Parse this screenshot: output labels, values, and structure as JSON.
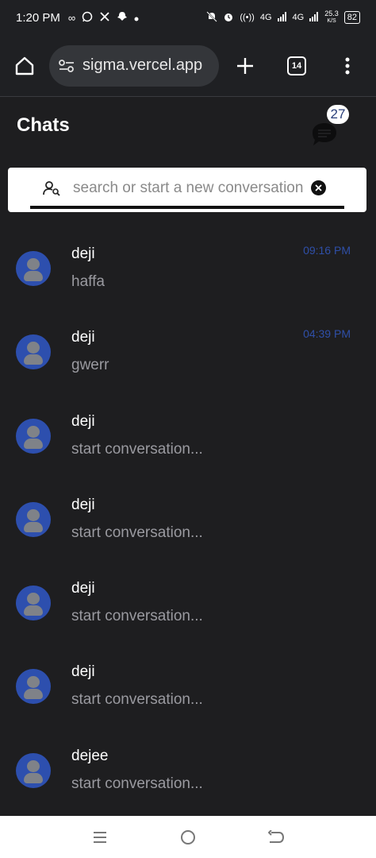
{
  "status_bar": {
    "time": "1:20 PM",
    "left_icons": [
      "infinity-icon",
      "whatsapp-icon",
      "x-icon",
      "snapchat-icon",
      "dot-icon"
    ],
    "network_1": "4G",
    "network_2": "4G",
    "speed": "25.3",
    "speed_unit": "K/S",
    "battery": "82"
  },
  "browser": {
    "url": "sigma.vercel.app",
    "tab_count": "14"
  },
  "header": {
    "title": "Chats",
    "unread_count": "27"
  },
  "search": {
    "placeholder": "search or start a new conversation"
  },
  "chats": [
    {
      "name": "deji",
      "preview": "haffa",
      "time": "09:16 PM"
    },
    {
      "name": "deji",
      "preview": "gwerr",
      "time": "04:39 PM"
    },
    {
      "name": "deji",
      "preview": "start conversation...",
      "time": ""
    },
    {
      "name": "deji",
      "preview": "start conversation...",
      "time": ""
    },
    {
      "name": "deji",
      "preview": "start conversation...",
      "time": ""
    },
    {
      "name": "deji",
      "preview": "start conversation...",
      "time": ""
    },
    {
      "name": "dejee",
      "preview": "start conversation...",
      "time": ""
    }
  ],
  "colors": {
    "background": "#1e1e20",
    "avatar": "#2d4fae",
    "timestamp": "#2f4fa8",
    "browser_bar": "#1f2023"
  }
}
